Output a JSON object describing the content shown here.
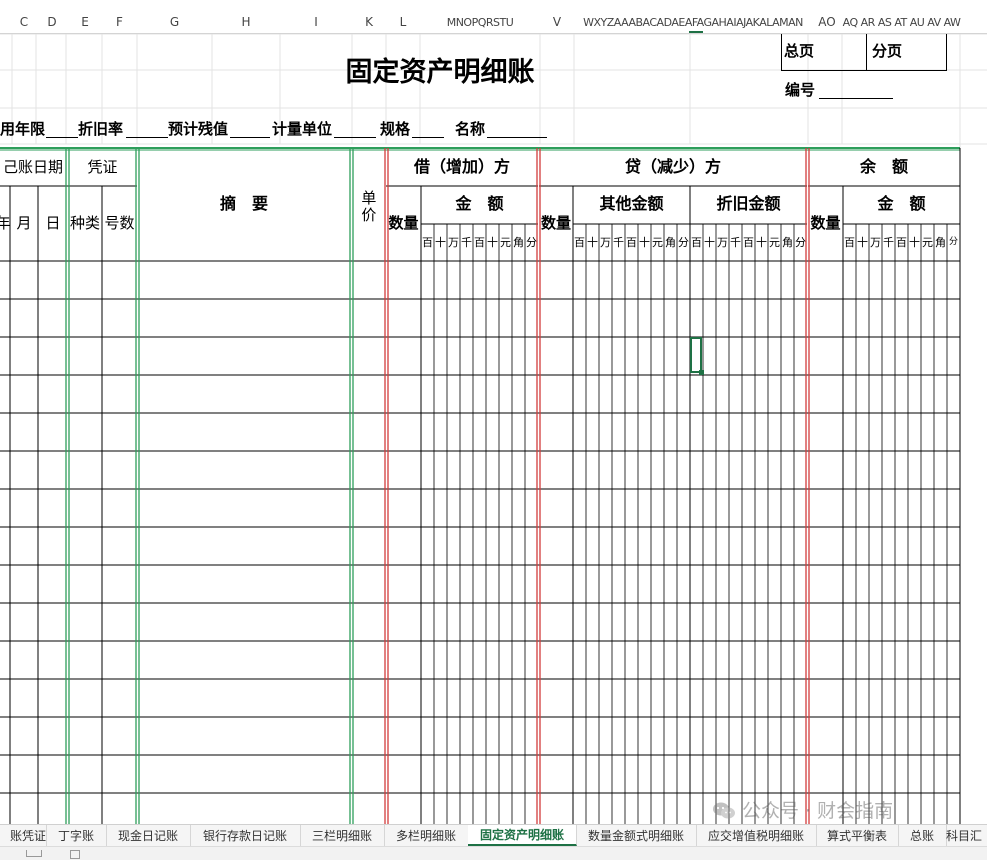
{
  "column_headers": [
    "C",
    "D",
    "E",
    "F",
    "G",
    "H",
    "I",
    "K",
    "L",
    "MNOPQRSTU",
    "V",
    "WXYZAAABACADAEAFAGAHAIAJAKALAMAN",
    "AO",
    "AP AQ AR AS AT AU AV AW AX"
  ],
  "sheet": {
    "title": "固定资产明细账",
    "page_total_label": "总页",
    "page_sub_label": "分页",
    "number_label": "编号",
    "info_fields": [
      "用年限",
      "折旧率",
      "预计残值",
      "计量单位",
      "规格",
      "名称"
    ],
    "headers": {
      "date": "己账日期",
      "year": "年",
      "month": "月",
      "day": "日",
      "voucher": "凭证",
      "voucher_type": "种类",
      "voucher_no": "号数",
      "summary": "摘　要",
      "unit_price": "单价",
      "debit": "借（增加）方",
      "credit": "贷（减少）方",
      "balance": "余　额",
      "quantity": "数量",
      "amount": "金　额",
      "other_amount": "其他金额",
      "depreciation_amount": "折旧金额",
      "digits": [
        "百",
        "十",
        "万",
        "千",
        "百",
        "十",
        "元",
        "角",
        "分"
      ]
    }
  },
  "tabs": [
    "账凭证",
    "丁字账",
    "现金日记账",
    "银行存款日记账",
    "三栏明细账",
    "多栏明细账",
    "固定资产明细账",
    "数量金额式明细账",
    "应交增值税明细账",
    "算式平衡表",
    "总账",
    "科目汇"
  ],
  "active_tab": "固定资产明细账",
  "watermark": "公众号 · 财会指南",
  "colors": {
    "accent_green": "#1e7145",
    "border_green": "#2e9e5b",
    "border_red": "#d23c3c",
    "gridline": "#e3e3e3"
  },
  "icons": [
    "wechat-icon"
  ]
}
